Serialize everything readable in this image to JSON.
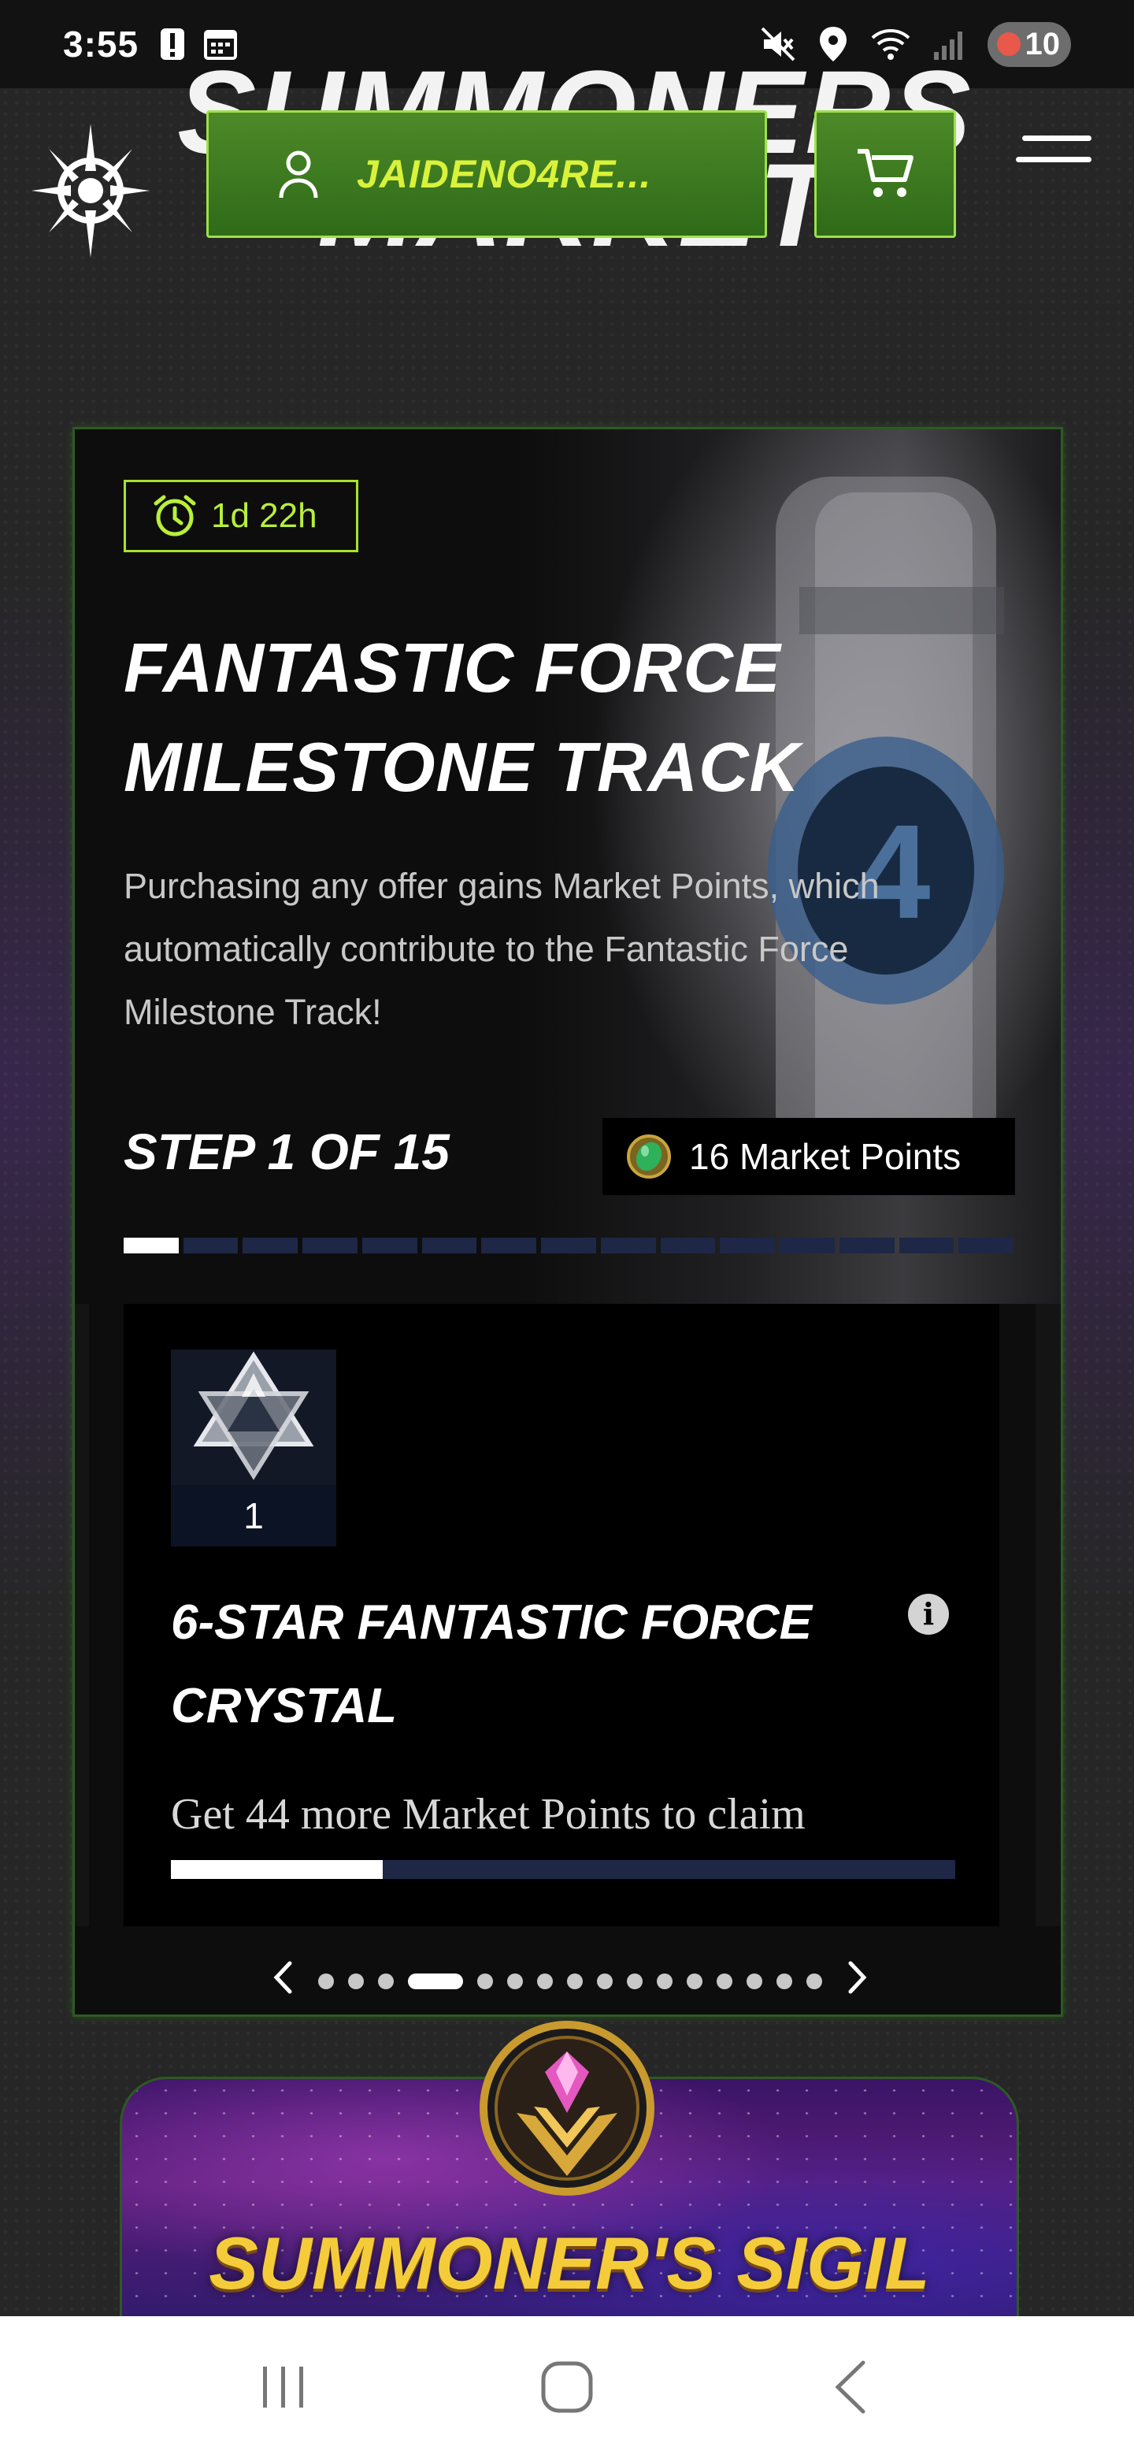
{
  "status_bar": {
    "time": "3:55",
    "notification_count": "10"
  },
  "header": {
    "background_logo_line1": "SUMMONERS",
    "background_logo_line2": "MARKET",
    "account_name": "JAIDENO4RE...",
    "icons": [
      "user-icon",
      "cart-icon",
      "menu-icon",
      "brand-logo"
    ]
  },
  "milestone": {
    "timer": "1d 22h",
    "title_line1": "FANTASTIC FORCE",
    "title_line2": "MILESTONE TRACK",
    "description": "Purchasing any offer gains Market Points, which automatically contribute to the Fantastic Force Milestone Track!",
    "step_label": "STEP 1 OF 15",
    "points_label": "16 Market Points",
    "total_steps": 15,
    "current_step": 1,
    "reward": {
      "quantity": "1",
      "title": "6-STAR FANTASTIC FORCE CRYSTAL",
      "progress_text": "Get 44 more Market Points to claim",
      "progress_fraction": 0.27
    },
    "carousel": {
      "dot_count": 16,
      "active_index": 3
    }
  },
  "sigil": {
    "title": "SUMMONER'S SIGIL"
  },
  "colors": {
    "accent_green": "#9ee04c",
    "timer_green": "#b9ef3a",
    "account_text": "#d9f23a",
    "sigil_gold": "#f4cc3a",
    "track_inactive": "#1e2745"
  }
}
